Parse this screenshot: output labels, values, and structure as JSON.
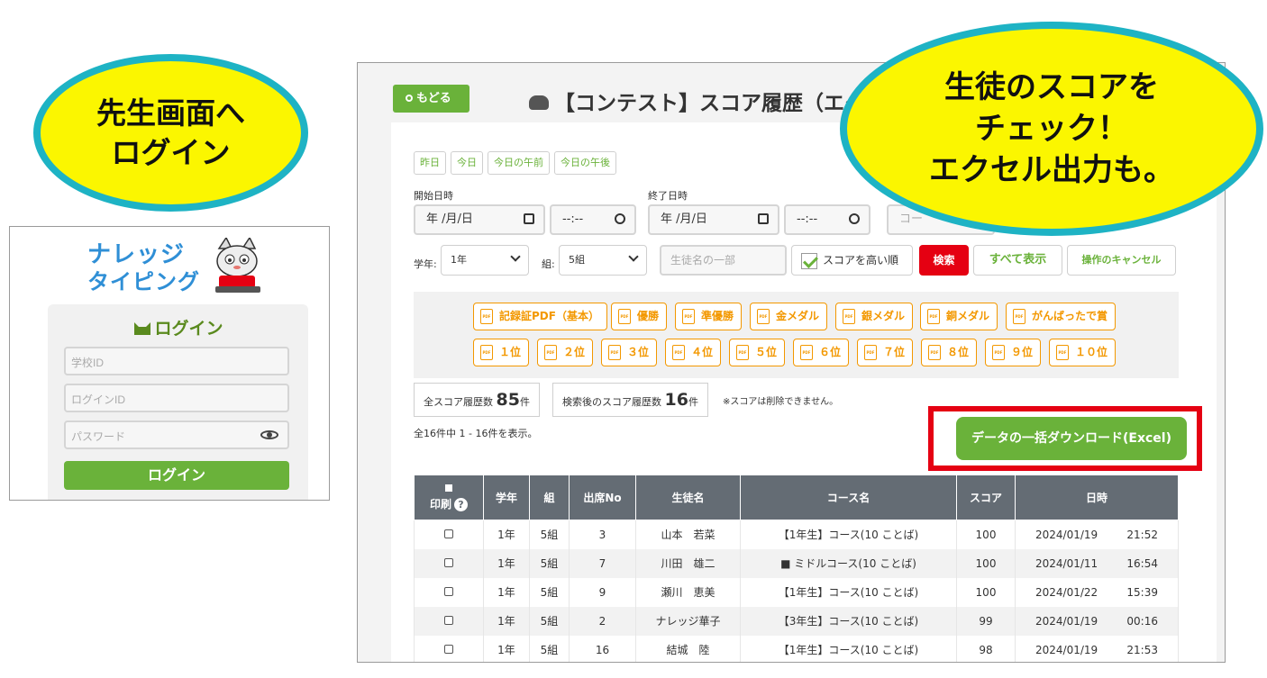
{
  "callouts": {
    "left": [
      "先生画面へ",
      "ログイン"
    ],
    "right": [
      "生徒のスコアを",
      "チェック！",
      "エクセル出力も。"
    ]
  },
  "login": {
    "logo_top": "ナレッジ",
    "logo_bottom": "タイピング",
    "title": "ログイン",
    "school_id_placeholder": "学校ID",
    "login_id_placeholder": "ログインID",
    "password_placeholder": "パスワード",
    "submit_label": "ログイン"
  },
  "header": {
    "back_label": "もどる",
    "title": "【コンテスト】スコア履歴（エクセル"
  },
  "quick_filters": [
    "昨日",
    "今日",
    "今日の午前",
    "今日の午後"
  ],
  "filters": {
    "start_label": "開始日時",
    "end_label": "終了日時",
    "date_placeholder": "年 /月/日",
    "time_placeholder": "--:--",
    "course_placeholder": "コー",
    "grade_label": "学年:",
    "grade_value": "1年",
    "class_label": "組:",
    "class_value": "5組",
    "name_placeholder": "生徒名の一部",
    "sort_label": "スコアを高い順",
    "search_label": "検索",
    "show_all_label": "すべて表示",
    "cancel_label": "操作のキャンセル"
  },
  "pdf_buttons_row1": [
    "記録証PDF（基本）",
    "優勝",
    "準優勝",
    "金メダル",
    "銀メダル",
    "銅メダル",
    "がんばったで賞"
  ],
  "pdf_buttons_row2": [
    "１位",
    "２位",
    "３位",
    "４位",
    "５位",
    "６位",
    "７位",
    "８位",
    "９位",
    "１０位"
  ],
  "pdf_icon_text": "PDF",
  "counts": {
    "total_label": "全スコア履歴数",
    "total_value": "85",
    "filtered_label": "検索後のスコア履歴数",
    "filtered_value": "16",
    "unit": "件",
    "note": "※スコアは削除できません。",
    "showing": "全16件中 1 - 16件を表示。"
  },
  "download_label": "データの一括ダウンロード(Excel)",
  "table": {
    "headers": [
      "印刷",
      "学年",
      "組",
      "出席No",
      "生徒名",
      "コース名",
      "スコア",
      "日時"
    ],
    "rows": [
      {
        "grade": "1年",
        "class": "5組",
        "no": "3",
        "name": "山本　若菜",
        "course": "【1年生】コース(10 ことば)",
        "score": "100",
        "date": "2024/01/19",
        "time": "21:52"
      },
      {
        "grade": "1年",
        "class": "5組",
        "no": "7",
        "name": "川田　雄二",
        "course": "■ ミドルコース(10 ことば)",
        "score": "100",
        "date": "2024/01/11",
        "time": "16:54"
      },
      {
        "grade": "1年",
        "class": "5組",
        "no": "9",
        "name": "瀬川　恵美",
        "course": "【1年生】コース(10 ことば)",
        "score": "100",
        "date": "2024/01/22",
        "time": "15:39"
      },
      {
        "grade": "1年",
        "class": "5組",
        "no": "2",
        "name": "ナレッジ華子",
        "course": "【3年生】コース(10 ことば)",
        "score": "99",
        "date": "2024/01/19",
        "time": "00:16"
      },
      {
        "grade": "1年",
        "class": "5組",
        "no": "16",
        "name": "結城　陸",
        "course": "【1年生】コース(10 ことば)",
        "score": "98",
        "date": "2024/01/19",
        "time": "21:53"
      }
    ]
  },
  "colors": {
    "accent": "#6ab23a",
    "pdf": "#f39800",
    "danger": "#e50012",
    "callout": "#fbf600",
    "callout_border": "#1eb3c4"
  }
}
